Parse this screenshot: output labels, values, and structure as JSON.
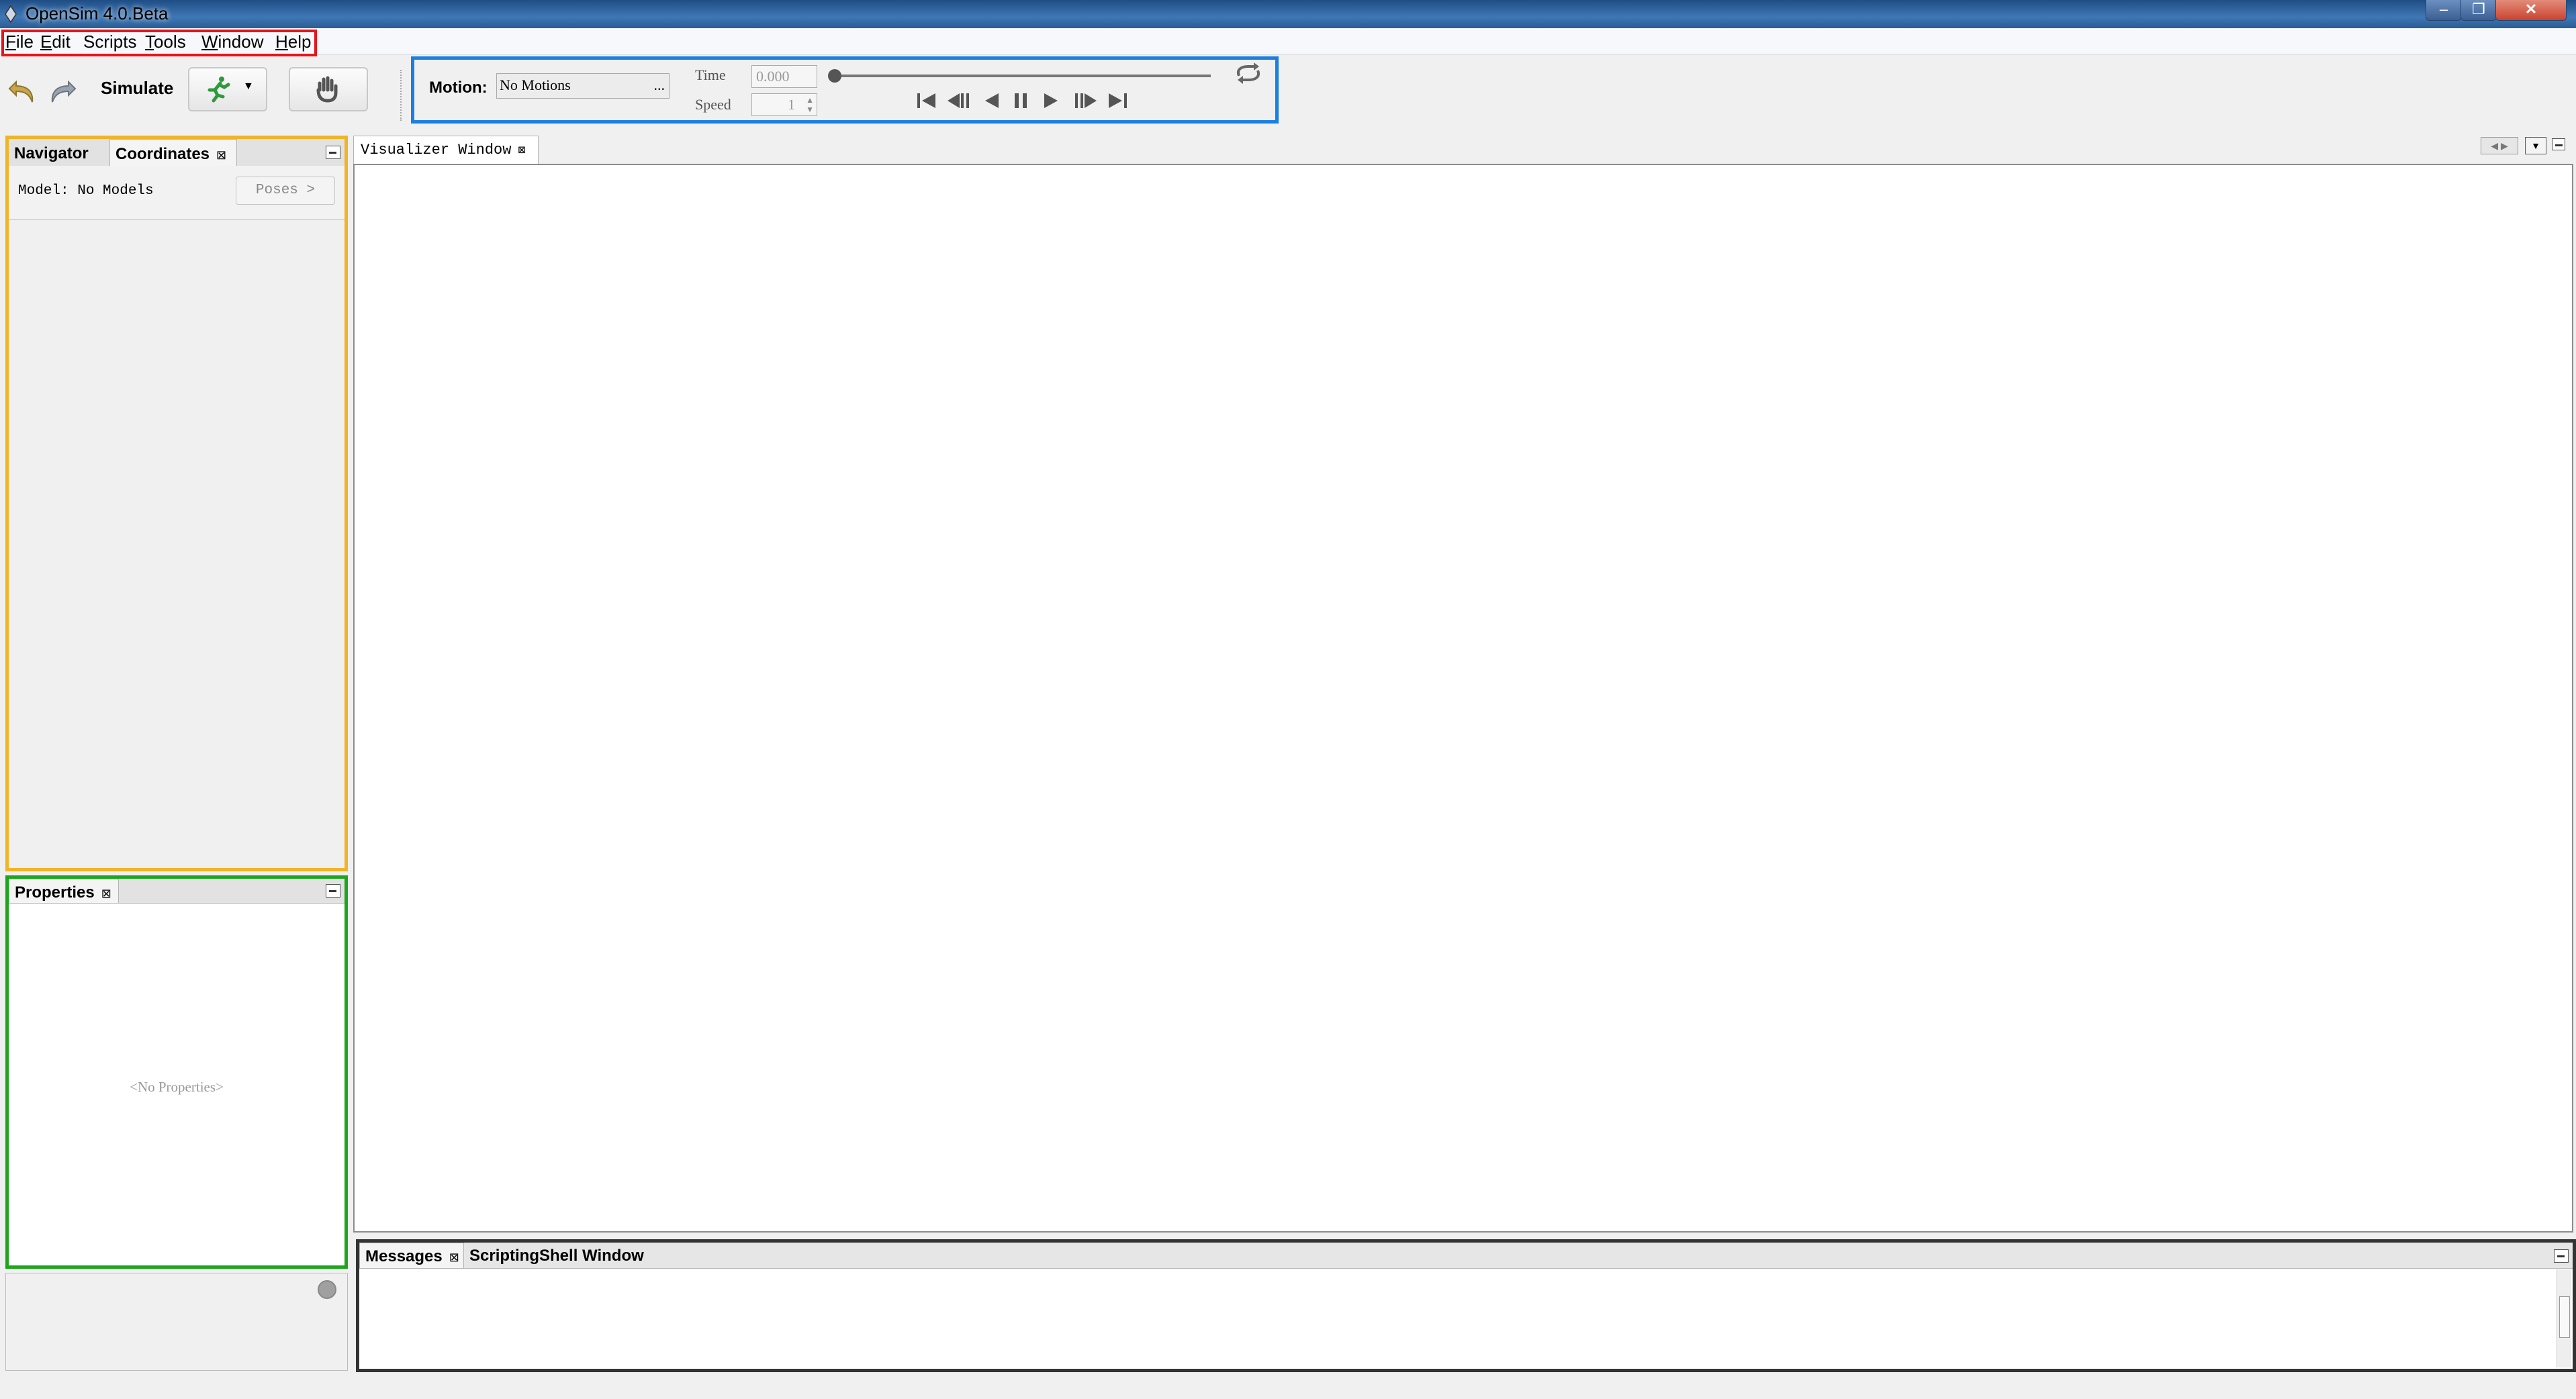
{
  "window": {
    "title": "OpenSim 4.0.Beta",
    "minimize": "–",
    "maximize": "❐",
    "close": "✕"
  },
  "menu": [
    {
      "accel": "F",
      "rest": "ile"
    },
    {
      "accel": "E",
      "rest": "dit"
    },
    {
      "accel": "",
      "rest": "Scripts"
    },
    {
      "accel": "T",
      "rest": "ools"
    },
    {
      "accel": "W",
      "rest": "indow"
    },
    {
      "accel": "H",
      "rest": "elp"
    }
  ],
  "toolbar": {
    "simulate_label": "Simulate",
    "icons": {
      "undo": "undo-icon",
      "redo": "redo-icon",
      "run": "running-figure-icon",
      "hand": "hand-icon"
    }
  },
  "motion": {
    "label": "Motion:",
    "selected": "No Motions",
    "browse": "...",
    "time_label": "Time",
    "time_value": "0.000",
    "speed_label": "Speed",
    "speed_value": "1",
    "slider_position": 0,
    "buttons": [
      "skip-to-start",
      "step-back",
      "play-reverse",
      "pause",
      "play",
      "step-forward",
      "skip-to-end",
      "loop"
    ]
  },
  "navigator_panel": {
    "tabs": [
      {
        "label": "Navigator"
      },
      {
        "label": "Coordinates",
        "close": "⊠"
      }
    ],
    "model_label": "Model: No Models",
    "poses_button": "Poses >"
  },
  "properties_panel": {
    "tab": {
      "label": "Properties",
      "close": "⊠"
    },
    "empty_text": "<No Properties>"
  },
  "visualizer": {
    "tab": {
      "label": "Visualizer Window",
      "close": "⊠"
    }
  },
  "messages_panel": {
    "tabs": [
      {
        "label": "Messages",
        "close": "⊠"
      },
      {
        "label": "ScriptingShell Window"
      }
    ]
  },
  "colors": {
    "menu_highlight": "#e8141c",
    "motion_highlight": "#1a7fe0",
    "navigator_highlight": "#f0b428",
    "properties_highlight": "#1ea51e"
  }
}
